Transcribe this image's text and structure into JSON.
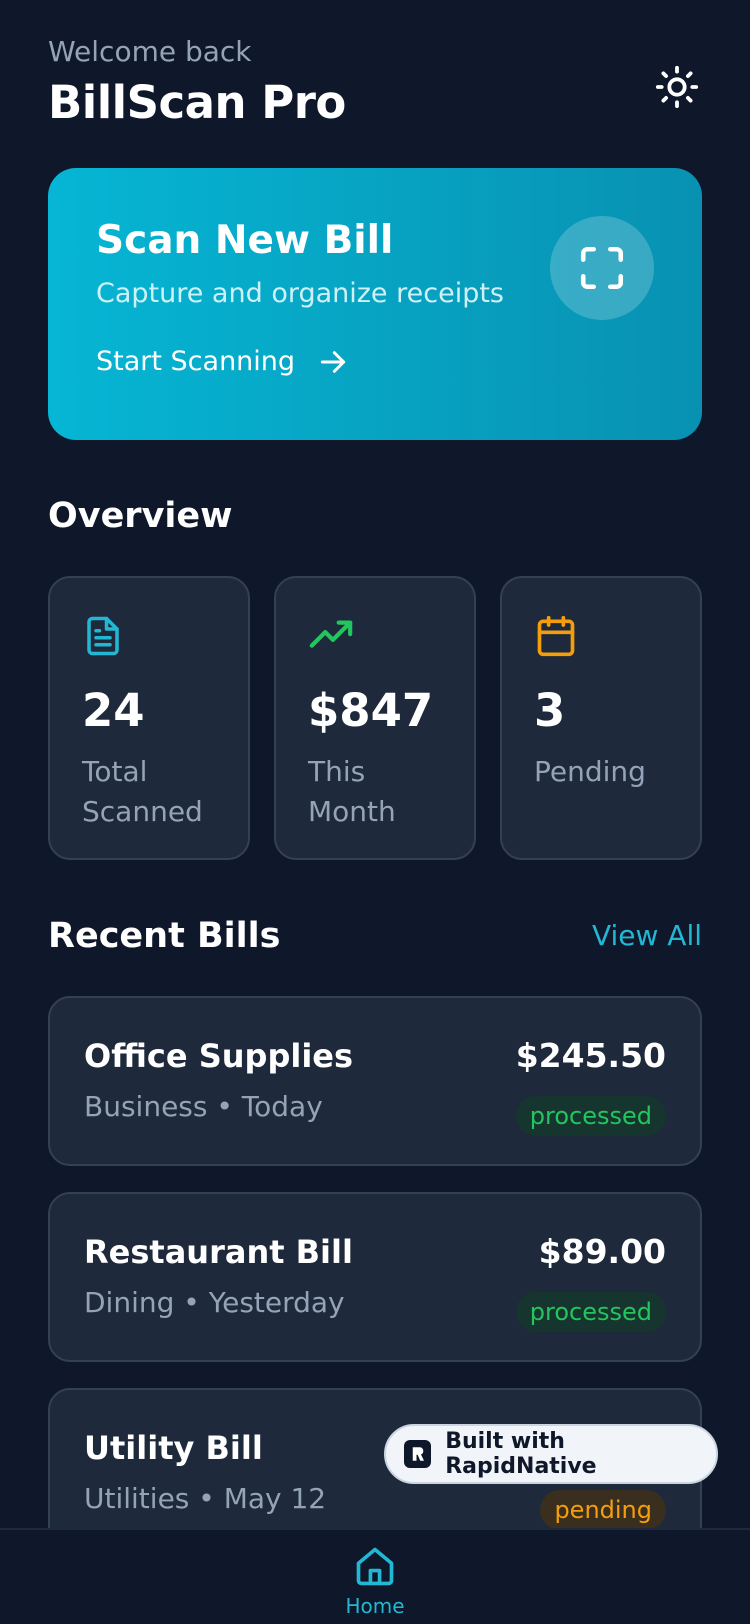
{
  "header": {
    "welcome": "Welcome back",
    "app_title": "BillScan Pro",
    "theme_icon": "sun-icon"
  },
  "scan_card": {
    "title": "Scan New Bill",
    "subtitle": "Capture and organize receipts",
    "cta": "Start Scanning",
    "icon": "scan-frame-icon",
    "gradient": [
      "#06b6d4",
      "#0891b2"
    ]
  },
  "overview": {
    "title": "Overview",
    "stats": [
      {
        "icon": "document-icon",
        "value": "24",
        "label_line1": "Total",
        "label_line2": "Scanned",
        "color": "#22b8d4"
      },
      {
        "icon": "trending-up-icon",
        "value": "$847",
        "label_line1": "This",
        "label_line2": "Month",
        "color": "#22c55e"
      },
      {
        "icon": "calendar-icon",
        "value": "3",
        "label_line1": "Pending",
        "label_line2": "",
        "color": "#f59e0b"
      }
    ]
  },
  "recent": {
    "title": "Recent Bills",
    "view_all": "View All",
    "bills": [
      {
        "name": "Office Supplies",
        "meta": "Business • Today",
        "amount": "$245.50",
        "status": "processed"
      },
      {
        "name": "Restaurant Bill",
        "meta": "Dining • Yesterday",
        "amount": "$89.00",
        "status": "processed"
      },
      {
        "name": "Utility Bill",
        "meta": "Utilities • May 12",
        "amount": "",
        "status": "pending"
      }
    ]
  },
  "rapidnative": {
    "label": "Built with RapidNative"
  },
  "tabbar": {
    "home_label": "Home",
    "accent": "#22b8d4"
  }
}
